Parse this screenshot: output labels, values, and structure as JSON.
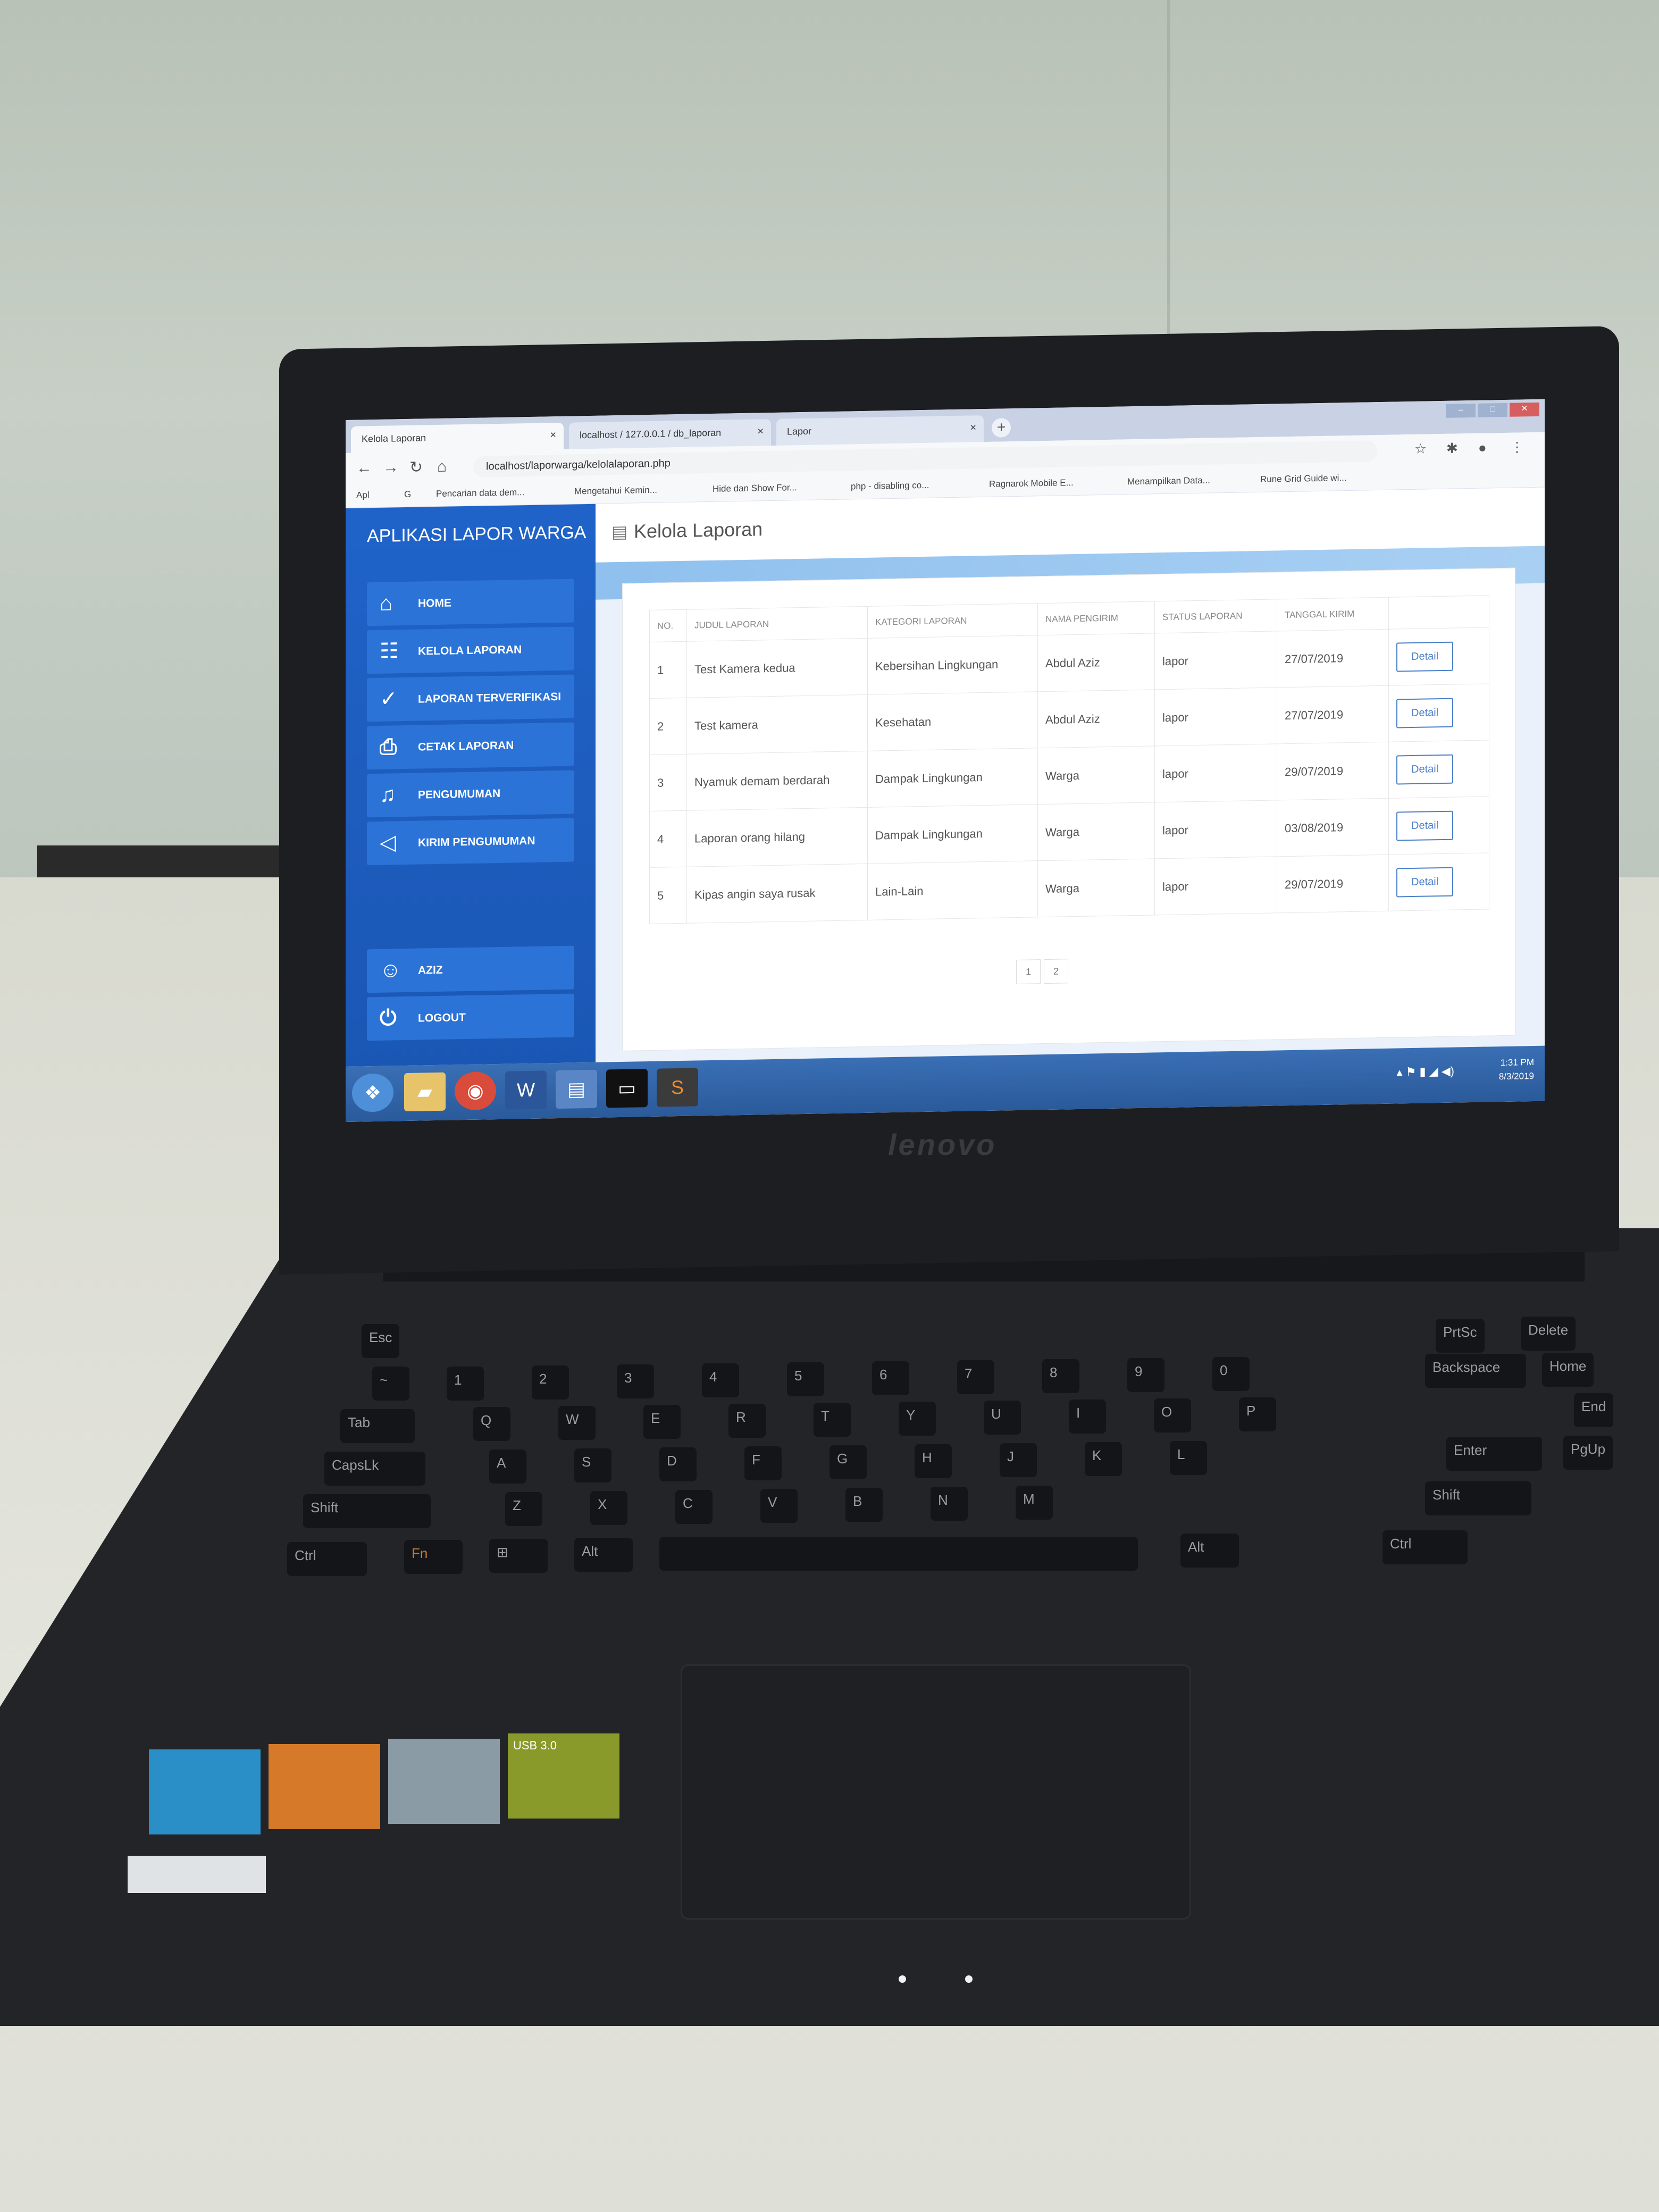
{
  "browser": {
    "tabs": [
      {
        "label": "Kelola Laporan",
        "close": "×",
        "active": true
      },
      {
        "label": "localhost / 127.0.0.1 / db_laporan",
        "close": "×",
        "active": false
      },
      {
        "label": "Lapor",
        "close": "×",
        "active": false
      }
    ],
    "new_tab": "+",
    "url": "localhost/laporwarga/kelolalaporan.php",
    "bookmarks": [
      "Apl",
      "G",
      "Pencarian data dem...",
      "Mengetahui Kemin...",
      "Hide dan Show For...",
      "php - disabling co...",
      "Ragnarok Mobile E...",
      "Menampilkan Data...",
      "Rune Grid Guide wi..."
    ]
  },
  "app": {
    "title": "APLIKASI LAPOR WARGA",
    "nav": [
      {
        "label": "HOME",
        "icon": "home-icon",
        "glyph": "⌂"
      },
      {
        "label": "KELOLA LAPORAN",
        "icon": "clipboard-icon",
        "glyph": "☷"
      },
      {
        "label": "LAPORAN TERVERIFIKASI",
        "icon": "check-circle-icon",
        "glyph": "✓"
      },
      {
        "label": "CETAK LAPORAN",
        "icon": "print-icon",
        "glyph": "⎙"
      },
      {
        "label": "PENGUMUMAN",
        "icon": "bell-icon",
        "glyph": "♫"
      },
      {
        "label": "KIRIM PENGUMUMAN",
        "icon": "megaphone-icon",
        "glyph": "◁"
      }
    ],
    "user": {
      "label": "AZIZ",
      "icon": "user-icon",
      "glyph": "☺"
    },
    "logout": {
      "label": "LOGOUT",
      "icon": "power-icon",
      "glyph": "⏻"
    },
    "page_title": "Kelola Laporan",
    "table": {
      "headers": [
        "NO.",
        "JUDUL LAPORAN",
        "KATEGORI LAPORAN",
        "NAMA PENGIRIM",
        "STATUS LAPORAN",
        "TANGGAL KIRIM",
        ""
      ],
      "rows": [
        [
          "1",
          "Test Kamera kedua",
          "Kebersihan Lingkungan",
          "Abdul Aziz",
          "lapor",
          "27/07/2019"
        ],
        [
          "2",
          "Test kamera",
          "Kesehatan",
          "Abdul Aziz",
          "lapor",
          "27/07/2019"
        ],
        [
          "3",
          "Nyamuk demam berdarah",
          "Dampak Lingkungan",
          "Warga",
          "lapor",
          "29/07/2019"
        ],
        [
          "4",
          "Laporan orang hilang",
          "Dampak Lingkungan",
          "Warga",
          "lapor",
          "03/08/2019"
        ],
        [
          "5",
          "Kipas angin saya rusak",
          "Lain-Lain",
          "Warga",
          "lapor",
          "29/07/2019"
        ]
      ],
      "action_label": "Detail"
    },
    "pagination": [
      "1",
      "2"
    ]
  },
  "taskbar": {
    "clock_time": "1:31 PM",
    "clock_date": "8/3/2019",
    "icons": [
      "start-icon",
      "folder-icon",
      "chrome-icon",
      "word-icon",
      "files-icon",
      "terminal-icon",
      "sublime-icon"
    ]
  },
  "laptop": {
    "brand": "lenovo",
    "stickers": [
      "USB 3.0"
    ]
  },
  "keyboard": {
    "row1": [
      "Esc",
      "PrtSc",
      "Delete"
    ],
    "row2": [
      "~",
      "1",
      "2",
      "3",
      "4",
      "5",
      "6",
      "7",
      "8",
      "9",
      "0",
      "Backspace",
      "Home"
    ],
    "row3": [
      "Tab",
      "Q",
      "W",
      "E",
      "R",
      "T",
      "Y",
      "U",
      "I",
      "O",
      "P",
      "End"
    ],
    "row4": [
      "CapsLk",
      "A",
      "S",
      "D",
      "F",
      "G",
      "H",
      "J",
      "K",
      "L",
      "Enter",
      "PgUp"
    ],
    "row5": [
      "Shift",
      "Z",
      "X",
      "C",
      "V",
      "B",
      "N",
      "M",
      "Shift"
    ],
    "row6": [
      "Ctrl",
      "Fn",
      "Alt",
      "Alt",
      "Ctrl"
    ]
  },
  "colors": {
    "sidebar": "#1f63c9",
    "nav_item": "#2b73d6",
    "detail_button": "#4a7fc8",
    "taskbar": "#2a5a9a"
  }
}
